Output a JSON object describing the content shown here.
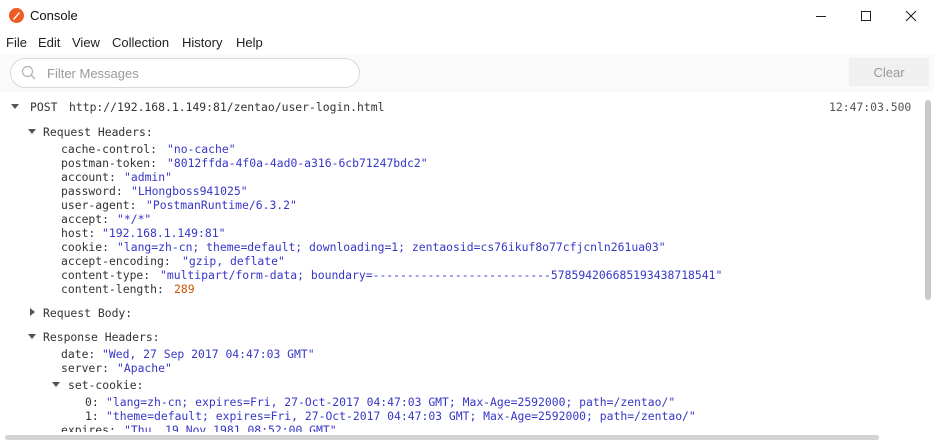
{
  "window": {
    "title": "Console"
  },
  "menu": [
    "File",
    "Edit",
    "View",
    "Collection",
    "History",
    "Help"
  ],
  "filter": {
    "placeholder": "Filter Messages",
    "value": "",
    "clear_label": "Clear"
  },
  "log": {
    "method": "POST",
    "url": "http://192.168.1.149:81/zentao/user-login.html",
    "timestamp": "12:47:03.500",
    "request_headers_label": "Request Headers:",
    "request_headers": [
      {
        "key": "cache-control:",
        "value": "\"no-cache\""
      },
      {
        "key": "postman-token:",
        "value": "\"8012ffda-4f0a-4ad0-a316-6cb71247bdc2\""
      },
      {
        "key": "account:",
        "value": "\"admin\""
      },
      {
        "key": "password:",
        "value": "\"LHongboss941025\""
      },
      {
        "key": "user-agent:",
        "value": "\"PostmanRuntime/6.3.2\""
      },
      {
        "key": "accept:",
        "value": "\"*/*\""
      },
      {
        "key": "host:",
        "value": "\"192.168.1.149:81\""
      },
      {
        "key": "cookie:",
        "value": "\"lang=zh-cn; theme=default; downloading=1; zentaosid=cs76ikuf8o77cfjcnln261ua03\""
      },
      {
        "key": "accept-encoding:",
        "value": "\"gzip, deflate\""
      },
      {
        "key": "content-type:",
        "value": "\"multipart/form-data; boundary=--------------------------578594206685193438718541\""
      },
      {
        "key": "content-length:",
        "value": "289"
      }
    ],
    "request_body_label": "Request Body:",
    "response_headers_label": "Response Headers:",
    "response_headers": [
      {
        "key": "date:",
        "value": "\"Wed, 27 Sep 2017 04:47:03 GMT\""
      },
      {
        "key": "server:",
        "value": "\"Apache\""
      }
    ],
    "set_cookie_label": "set-cookie:",
    "set_cookie": [
      {
        "key": "0:",
        "value": "\"lang=zh-cn; expires=Fri, 27-Oct-2017 04:47:03 GMT; Max-Age=2592000; path=/zentao/\""
      },
      {
        "key": "1:",
        "value": "\"theme=default; expires=Fri, 27-Oct-2017 04:47:03 GMT; Max-Age=2592000; path=/zentao/\""
      }
    ],
    "expires": {
      "key": "expires:",
      "value": "\"Thu, 19 Nov 1981 08:52:00 GMT\""
    }
  }
}
